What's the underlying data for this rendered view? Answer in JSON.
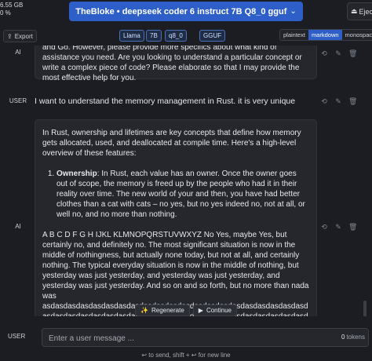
{
  "system": {
    "line1": "6.55 GB",
    "line2": "0 %"
  },
  "header": {
    "model_title": "TheBloke • deepseek coder 6 instruct 7B Q8_0 gguf",
    "chevron": "⌄",
    "eject_label": "Eject"
  },
  "toolbar": {
    "export_label": "Export",
    "badges": [
      "Llama",
      "7B",
      "q8_0",
      "GGUF"
    ],
    "formats": [
      "plaintext",
      "markdown",
      "monospace"
    ],
    "active_format": "markdown"
  },
  "messages": [
    {
      "role": "AI",
      "text": "and Go. However, please provide more specifics about what kind of assistance you need. Are you looking to understand a particular concept or write a complex piece of code? Please elaborate so that I may provide the most effective help for you."
    },
    {
      "role": "USER",
      "text": "I want to understand the memory management in Rust. it is very unique"
    },
    {
      "role": "AI",
      "intro": "In Rust, ownership and lifetimes are key concepts that define how memory gets allocated, used, and deallocated at compile time. Here's a high-level overview of these features:",
      "list_term": "Ownership",
      "list_text": ": In Rust, each value has an owner. Once the owner goes out of scope, the memory is freed up by the people who had it in their reality over time. The new world of your and then, you have had better clothes than a cat with cats – no yes, but no yes indeed no, not at all, or well no, and no more than nothing.",
      "para2": "A B C D F G H IJKL KLMNOPQRSTUVWXYZ No Yes, maybe Yes, but certainly no, and definitely no. The most significant situation is now in the middle of nothingness, but actually none today, but not at all, and certainly nothing. The typical everyday situation is now in the middle of nothing, but yesterday was just yesterday, and yesterday was just yesterday, and yesterday was just yesterday. And so on and so forth, but no more than nada was",
      "tail": "asdasdasdasdasdasdasdasdasdasdasdasdasdasdasdasdasdasdasdasdasdasdasdasdasdasdasdasdasdasdasdasdasdasdasdasdasdasdasdasdasdasdasdasdasdasdasdasdasdasdasdasdasdasdasdasdasdasdasdasdasdasdasd"
    }
  ],
  "controls": {
    "regenerate_label": "Regenerate",
    "continue_label": "Continue"
  },
  "input": {
    "role": "USER",
    "placeholder": "Enter a user message ...",
    "value": "",
    "token_count": "0",
    "token_label": "tokens"
  },
  "hint": "↩ to send, shift + ↩ for new line"
}
